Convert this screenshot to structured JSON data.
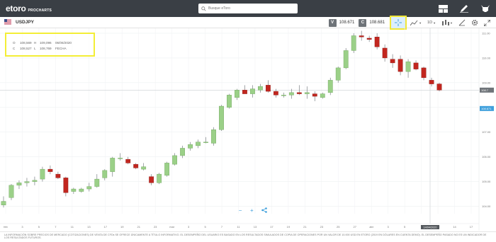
{
  "app": {
    "brand": "etoro",
    "product": "PROCHARTS"
  },
  "search": {
    "placeholder": "Busque eToro"
  },
  "colors": {
    "topbar": "#3a3f45",
    "bullish": "#9bd088",
    "bearish": "#c2261f",
    "highlight": "#f3ee36",
    "accent": "#3fa0dc"
  },
  "top_icons": [
    "layout-icon",
    "edit-pencil-icon",
    "bull-bear-icon"
  ],
  "toolbar": {
    "symbol": "USDJPY",
    "bid_label": "V",
    "bid_value": "108.671",
    "ask_label": "C",
    "ask_value": "108.681",
    "timeframe": "1D",
    "tools": [
      "crosshair-icon",
      "chart-type-icon",
      "timeframe-selector",
      "indicators-icon",
      "drawing-icon",
      "settings-icon",
      "fullscreen-icon"
    ]
  },
  "info": {
    "o_label": "O",
    "o_value": "108,569",
    "h_label": "H",
    "h_value": "109,096",
    "date_value": "06/06/2020",
    "c_label": "C",
    "c_value": "108,527",
    "l_label": "L",
    "l_value": "108,769",
    "close_label": "FECHA"
  },
  "chart_data": {
    "type": "candlestick",
    "y_ticks": [
      "111.00",
      "110.00",
      "109.00",
      "108.00",
      "107.00",
      "106.00",
      "105.00",
      "104.00"
    ],
    "price_tags": [
      {
        "label": "108.7",
        "value": 108.7,
        "style": "gray"
      },
      {
        "label": "108.671",
        "value": 108.671,
        "style": "blue"
      }
    ],
    "x_ticks": [
      "feb",
      "3",
      "5",
      "7",
      "11",
      "13",
      "17",
      "19",
      "21",
      "23",
      "mar",
      "3",
      "5",
      "7",
      "11",
      "13",
      "17",
      "19",
      "21",
      "23",
      "25",
      "27",
      "abr",
      "3",
      "5",
      "7",
      "10",
      "14",
      "17"
    ],
    "crosshair_date": "14/04/2020",
    "candles": [
      {
        "o": 104.05,
        "h": 104.4,
        "l": 103.95,
        "c": 104.2
      },
      {
        "o": 104.35,
        "h": 104.9,
        "l": 104.25,
        "c": 104.85
      },
      {
        "o": 104.85,
        "h": 105.05,
        "l": 104.7,
        "c": 104.95
      },
      {
        "o": 104.95,
        "h": 105.15,
        "l": 104.8,
        "c": 105.0
      },
      {
        "o": 105.0,
        "h": 105.2,
        "l": 104.85,
        "c": 105.05
      },
      {
        "o": 105.1,
        "h": 105.6,
        "l": 105.0,
        "c": 105.5
      },
      {
        "o": 105.5,
        "h": 105.65,
        "l": 105.3,
        "c": 105.4
      },
      {
        "o": 105.3,
        "h": 105.4,
        "l": 105.1,
        "c": 105.15
      },
      {
        "o": 105.15,
        "h": 105.2,
        "l": 104.4,
        "c": 104.55
      },
      {
        "o": 104.6,
        "h": 104.75,
        "l": 104.5,
        "c": 104.7
      },
      {
        "o": 104.6,
        "h": 104.75,
        "l": 104.55,
        "c": 104.7
      },
      {
        "o": 104.7,
        "h": 104.95,
        "l": 104.6,
        "c": 104.8
      },
      {
        "o": 104.8,
        "h": 105.3,
        "l": 104.75,
        "c": 105.1
      },
      {
        "o": 105.15,
        "h": 105.5,
        "l": 105.05,
        "c": 105.45
      },
      {
        "o": 105.4,
        "h": 106.0,
        "l": 105.2,
        "c": 105.95
      },
      {
        "o": 105.95,
        "h": 106.15,
        "l": 105.85,
        "c": 105.95
      },
      {
        "o": 105.9,
        "h": 106.0,
        "l": 105.7,
        "c": 105.75
      },
      {
        "o": 105.7,
        "h": 105.75,
        "l": 105.5,
        "c": 105.55
      },
      {
        "o": 105.5,
        "h": 105.75,
        "l": 105.45,
        "c": 105.6
      },
      {
        "o": 105.2,
        "h": 105.3,
        "l": 104.85,
        "c": 104.95
      },
      {
        "o": 104.95,
        "h": 105.35,
        "l": 104.9,
        "c": 105.3
      },
      {
        "o": 105.25,
        "h": 105.8,
        "l": 105.2,
        "c": 105.75
      },
      {
        "o": 105.7,
        "h": 106.15,
        "l": 105.65,
        "c": 106.05
      },
      {
        "o": 106.05,
        "h": 106.45,
        "l": 105.95,
        "c": 106.35
      },
      {
        "o": 106.35,
        "h": 106.6,
        "l": 106.25,
        "c": 106.5
      },
      {
        "o": 106.45,
        "h": 106.7,
        "l": 106.35,
        "c": 106.6
      },
      {
        "o": 106.6,
        "h": 106.8,
        "l": 106.55,
        "c": 106.6
      },
      {
        "o": 106.55,
        "h": 107.2,
        "l": 106.45,
        "c": 107.1
      },
      {
        "o": 107.1,
        "h": 108.1,
        "l": 107.05,
        "c": 108.05
      },
      {
        "o": 108.0,
        "h": 108.55,
        "l": 107.95,
        "c": 108.5
      },
      {
        "o": 108.4,
        "h": 108.75,
        "l": 108.3,
        "c": 108.7
      },
      {
        "o": 108.7,
        "h": 108.9,
        "l": 108.55,
        "c": 108.55
      },
      {
        "o": 108.55,
        "h": 108.9,
        "l": 108.4,
        "c": 108.75
      },
      {
        "o": 108.7,
        "h": 108.95,
        "l": 108.6,
        "c": 108.85
      },
      {
        "o": 108.9,
        "h": 109.1,
        "l": 108.6,
        "c": 108.65
      },
      {
        "o": 108.65,
        "h": 108.75,
        "l": 108.4,
        "c": 108.5
      },
      {
        "o": 108.5,
        "h": 108.6,
        "l": 108.4,
        "c": 108.5
      },
      {
        "o": 108.5,
        "h": 108.75,
        "l": 108.35,
        "c": 108.6
      },
      {
        "o": 108.6,
        "h": 108.9,
        "l": 108.5,
        "c": 108.55
      },
      {
        "o": 108.55,
        "h": 108.85,
        "l": 108.35,
        "c": 108.6
      },
      {
        "o": 108.55,
        "h": 108.65,
        "l": 108.25,
        "c": 108.45
      },
      {
        "o": 108.4,
        "h": 108.6,
        "l": 108.35,
        "c": 108.55
      },
      {
        "o": 108.6,
        "h": 109.2,
        "l": 108.5,
        "c": 109.1
      },
      {
        "o": 109.1,
        "h": 109.65,
        "l": 109.0,
        "c": 109.6
      },
      {
        "o": 109.6,
        "h": 110.4,
        "l": 109.55,
        "c": 110.3
      },
      {
        "o": 110.3,
        "h": 111.0,
        "l": 110.2,
        "c": 110.9
      },
      {
        "o": 110.9,
        "h": 111.1,
        "l": 110.7,
        "c": 110.85
      },
      {
        "o": 110.8,
        "h": 110.9,
        "l": 110.65,
        "c": 110.75
      },
      {
        "o": 110.85,
        "h": 111.0,
        "l": 110.35,
        "c": 110.45
      },
      {
        "o": 110.4,
        "h": 110.55,
        "l": 109.85,
        "c": 110.0
      },
      {
        "o": 109.95,
        "h": 110.15,
        "l": 109.6,
        "c": 109.8
      },
      {
        "o": 109.95,
        "h": 110.1,
        "l": 109.3,
        "c": 109.45
      },
      {
        "o": 109.45,
        "h": 109.95,
        "l": 109.2,
        "c": 109.85
      },
      {
        "o": 109.8,
        "h": 109.9,
        "l": 109.5,
        "c": 109.55
      },
      {
        "o": 109.6,
        "h": 109.65,
        "l": 109.1,
        "c": 109.2
      },
      {
        "o": 109.1,
        "h": 109.2,
        "l": 108.85,
        "c": 108.95
      },
      {
        "o": 108.95,
        "h": 109.0,
        "l": 108.65,
        "c": 108.7
      }
    ]
  },
  "bottom_controls": {
    "zoom_out": "−",
    "zoom_in": "+",
    "share_icon": "share-icon"
  },
  "disclaimer": "LA INFORMACIÓN SOBRE PRECIOS DE MERCADO (COTIZACIONES) DE VENTA DE CFDs SE OFRECE ÚNICAMENTE A TÍTULO INFORMATIVO. EL DESEMPEÑO DEL USUARIO ES BASADO EN LOS RESULTADOS SIMULADOS DE COPIA DE OPERACIONES POR UN VALOR DE 10.000 USD EN ETORO (2019 EN DÓLARES EN CUENTA DEMO). EL DESEMPEÑO PASADO NO ES UN INDICADOR DE LOS RESULTADOS FUTUROS."
}
